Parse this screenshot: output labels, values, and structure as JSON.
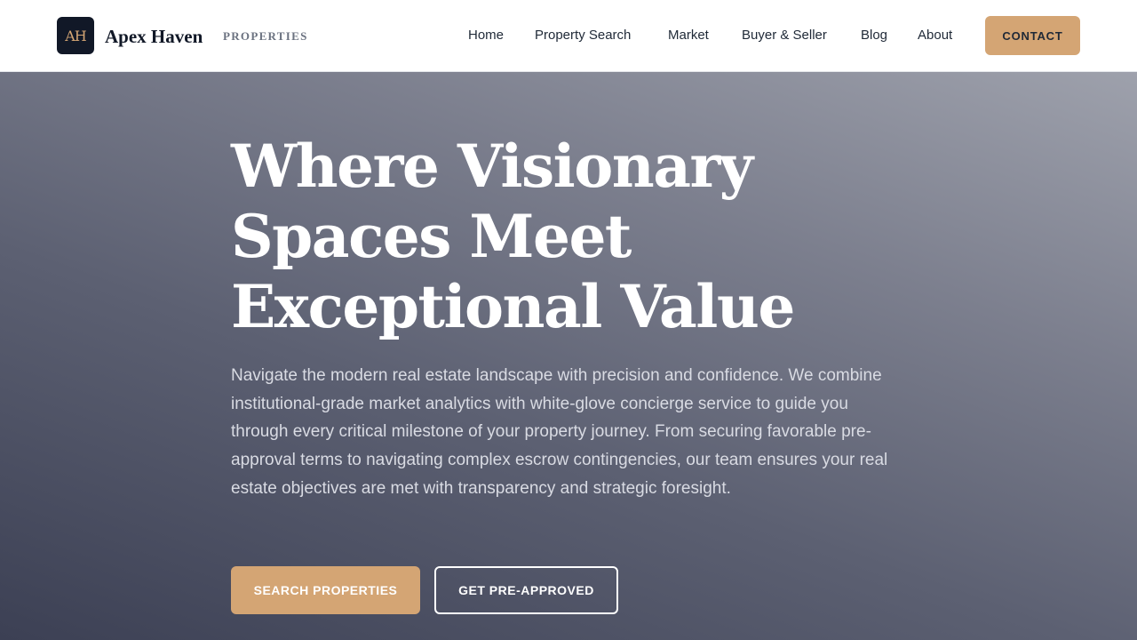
{
  "header": {
    "logo_initials": "AH",
    "brand_name": "Apex Haven",
    "brand_tag": "PROPERTIES",
    "nav": [
      {
        "label": "Home"
      },
      {
        "label": "Property Search"
      },
      {
        "label": "Market"
      },
      {
        "label": "Buyer & Seller"
      },
      {
        "label": "Blog"
      },
      {
        "label": "About"
      }
    ],
    "contact_label": "CONTACT"
  },
  "hero": {
    "title_lines": [
      "Where Visionary",
      "Spaces Meet",
      "Exceptional Value"
    ],
    "description": "Navigate the modern real estate landscape with precision and confidence. We combine institutional-grade market analytics with white-glove concierge service to guide you through every critical milestone of your property journey. From securing favorable pre-approval terms to navigating complex escrow contingencies, our team ensures your real estate objectives are met with transparency and strategic foresight.",
    "primary_cta": "SEARCH PROPERTIES",
    "secondary_cta": "GET PRE-APPROVED"
  },
  "colors": {
    "accent": "#d4a574",
    "dark": "#111827",
    "header_bg": "#ffffff"
  }
}
